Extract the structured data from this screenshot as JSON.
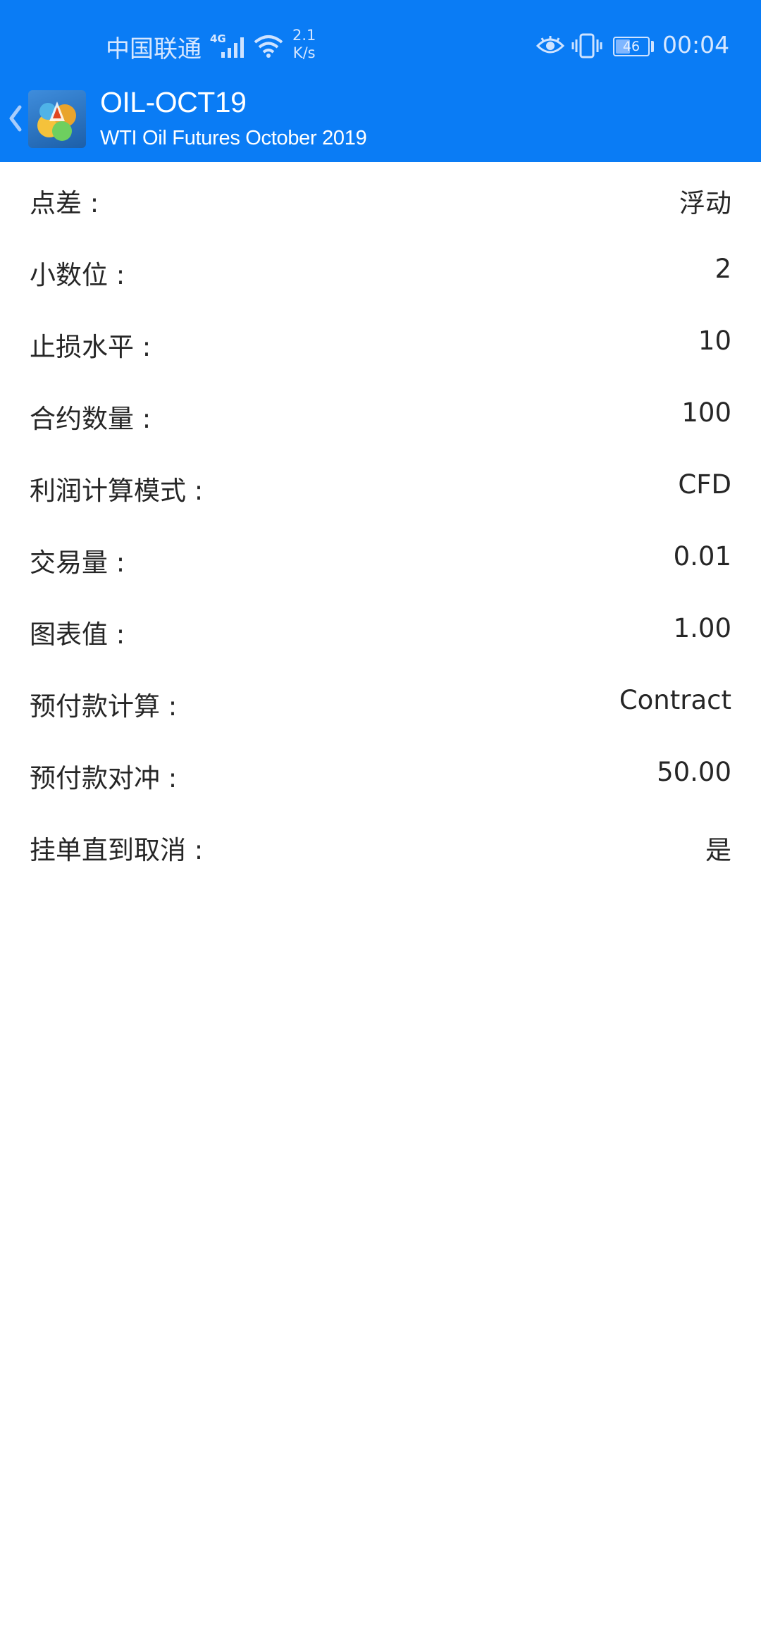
{
  "status_bar": {
    "carrier": "中国联通",
    "network": "4G",
    "speed_value": "2.1",
    "speed_unit": "K/s",
    "battery": "46",
    "battery_level": 0.46,
    "time": "00:04"
  },
  "header": {
    "back_icon": "chevron-left-icon",
    "logo_icon": "metatrader-logo-icon",
    "title": "OIL-OCT19",
    "subtitle": "WTI Oil Futures October 2019",
    "color": "#0a7cf5"
  },
  "properties": [
    {
      "label": "点差 :",
      "value": "浮动"
    },
    {
      "label": "小数位 :",
      "value": "2"
    },
    {
      "label": "止损水平 :",
      "value": "10"
    },
    {
      "label": "合约数量 :",
      "value": "100"
    },
    {
      "label": "利润计算模式 :",
      "value": "CFD"
    },
    {
      "label": "交易量 :",
      "value": "0.01"
    },
    {
      "label": "图表值 :",
      "value": "1.00"
    },
    {
      "label": "预付款计算 :",
      "value": "Contract"
    },
    {
      "label": "预付款对冲 :",
      "value": "50.00"
    },
    {
      "label": "挂单直到取消 :",
      "value": "是"
    }
  ]
}
